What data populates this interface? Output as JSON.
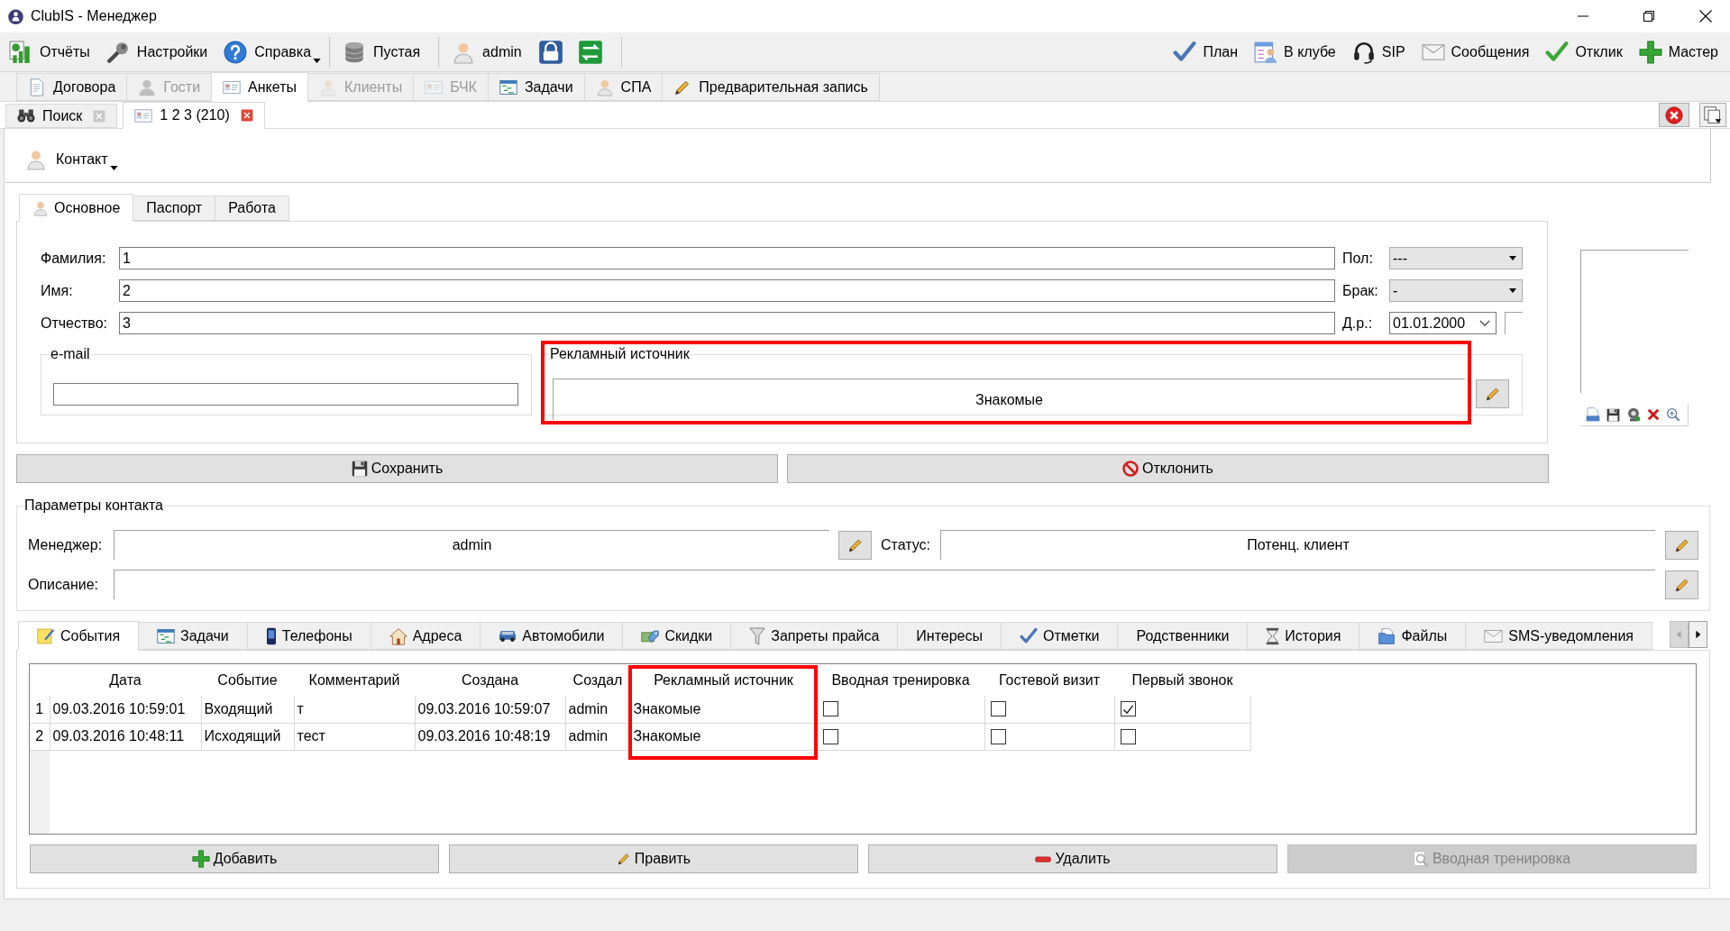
{
  "window": {
    "title": "ClubIS - Менеджер"
  },
  "toolbar": {
    "left_groups": [
      [
        {
          "label": "Отчёты",
          "dropdown": false
        },
        {
          "label": "Настройки",
          "dropdown": false
        },
        {
          "label": "Справка",
          "dropdown": true
        }
      ],
      [
        {
          "label": "Пустая",
          "dropdown": false
        }
      ],
      [
        {
          "label": "admin",
          "dropdown": false
        }
      ]
    ],
    "right": [
      {
        "label": "План"
      },
      {
        "label": "В клубе"
      },
      {
        "label": "SIP"
      },
      {
        "label": "Сообщения"
      },
      {
        "label": "Отклик"
      },
      {
        "label": "Мастер"
      }
    ]
  },
  "module_tabs": [
    {
      "label": "Договора",
      "selected": false,
      "disabled": false
    },
    {
      "label": "Гости",
      "selected": false,
      "disabled": true
    },
    {
      "label": "Анкеты",
      "selected": true,
      "disabled": false
    },
    {
      "label": "Клиенты",
      "selected": false,
      "disabled": true
    },
    {
      "label": "БЧК",
      "selected": false,
      "disabled": true
    },
    {
      "label": "Задачи",
      "selected": false,
      "disabled": false
    },
    {
      "label": "СПА",
      "selected": false,
      "disabled": false
    },
    {
      "label": "Предварительная запись",
      "selected": false,
      "disabled": false
    }
  ],
  "document_tabs": [
    {
      "label": "Поиск",
      "selected": false
    },
    {
      "label": "1 2 3 (210)",
      "selected": true
    }
  ],
  "contact_menu": {
    "label": "Контакт"
  },
  "form_tabs": [
    {
      "label": "Основное",
      "selected": true
    },
    {
      "label": "Паспорт",
      "selected": false
    },
    {
      "label": "Работа",
      "selected": false
    }
  ],
  "form": {
    "fields": [
      {
        "label": "Фамилия:",
        "value": "1"
      },
      {
        "label": "Имя:",
        "value": "2"
      },
      {
        "label": "Отчество:",
        "value": "3"
      }
    ],
    "side_fields": [
      {
        "label": "Пол:",
        "value": "---",
        "kind": "combo"
      },
      {
        "label": "Брак:",
        "value": "-",
        "kind": "combo"
      },
      {
        "label": "Д.р.:",
        "value": "01.01.2000",
        "kind": "date"
      }
    ],
    "email": {
      "title": "e-mail"
    },
    "ad_source": {
      "title": "Рекламный источник",
      "value": "Знакомые",
      "highlighted": true
    }
  },
  "form_buttons": [
    {
      "label": "Сохранить"
    },
    {
      "label": "Отклонить"
    }
  ],
  "contact_params": {
    "title": "Параметры контакта",
    "manager": {
      "label": "Менеджер:",
      "value": "admin"
    },
    "status": {
      "label": "Статус:",
      "value": "Потенц. клиент"
    },
    "description": {
      "label": "Описание:"
    }
  },
  "detail_tabs": [
    {
      "label": "События",
      "selected": true
    },
    {
      "label": "Задачи",
      "selected": false
    },
    {
      "label": "Телефоны",
      "selected": false
    },
    {
      "label": "Адреса",
      "selected": false
    },
    {
      "label": "Автомобили",
      "selected": false
    },
    {
      "label": "Скидки",
      "selected": false
    },
    {
      "label": "Запреты прайса",
      "selected": false
    },
    {
      "label": "Интересы",
      "selected": false
    },
    {
      "label": "Отметки",
      "selected": false
    },
    {
      "label": "Родственники",
      "selected": false
    },
    {
      "label": "История",
      "selected": false
    },
    {
      "label": "Файлы",
      "selected": false
    },
    {
      "label": "SMS-уведомления",
      "selected": false
    }
  ],
  "table": {
    "columns": [
      {
        "label": "Дата",
        "kind": "text",
        "highlighted": false
      },
      {
        "label": "Событие",
        "kind": "text",
        "highlighted": false
      },
      {
        "label": "Комментарий",
        "kind": "text",
        "highlighted": false
      },
      {
        "label": "Создана",
        "kind": "text",
        "highlighted": false
      },
      {
        "label": "Создал",
        "kind": "text",
        "highlighted": false
      },
      {
        "label": "Рекламный источник",
        "kind": "text",
        "highlighted": true
      },
      {
        "label": "Вводная тренировка",
        "kind": "checkbox",
        "highlighted": false
      },
      {
        "label": "Гостевой визит",
        "kind": "checkbox",
        "highlighted": false
      },
      {
        "label": "Первый звонок",
        "kind": "checkbox",
        "highlighted": false
      }
    ],
    "rows": [
      {
        "number": "1",
        "cells": [
          "09.03.2016 10:59:01",
          "Входящий",
          "т",
          "09.03.2016 10:59:07",
          "admin",
          "Знакомые",
          false,
          false,
          true
        ]
      },
      {
        "number": "2",
        "cells": [
          "09.03.2016 10:48:11",
          "Исходящий",
          "тест",
          "09.03.2016 10:48:19",
          "admin",
          "Знакомые",
          false,
          false,
          false
        ]
      }
    ]
  },
  "table_buttons": [
    {
      "label": "Добавить",
      "disabled": false
    },
    {
      "label": "Править",
      "disabled": false
    },
    {
      "label": "Удалить",
      "disabled": false
    },
    {
      "label": "Вводная тренировка",
      "disabled": true
    }
  ]
}
